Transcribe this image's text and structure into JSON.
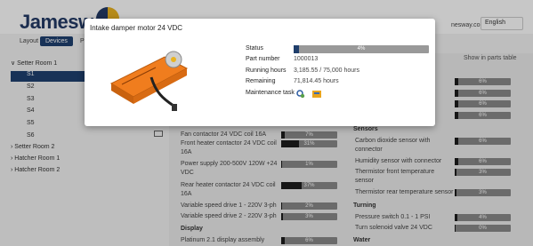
{
  "header": {
    "logo_text": "Jamesway",
    "user_text": "nesway.com ▾",
    "language": "English"
  },
  "tabs": [
    {
      "label": "Layout"
    },
    {
      "label": "Devices"
    },
    {
      "label": "Parts"
    },
    {
      "label": "C"
    }
  ],
  "tree": [
    {
      "label": "∨  Setter Room 1"
    },
    {
      "label": "S1"
    },
    {
      "label": "S2"
    },
    {
      "label": "S3"
    },
    {
      "label": "S4"
    },
    {
      "label": "S5"
    },
    {
      "label": "S6"
    },
    {
      "label": "›  Setter Room 2"
    },
    {
      "label": "›  Hatcher Room 1"
    },
    {
      "label": "›  Hatcher Room 2"
    }
  ],
  "right_header": "Show in parts table",
  "parts_left": [
    {
      "label": "Fan contactor 24 VDC coil 16A",
      "value": "7%",
      "fraction": 0.07
    },
    {
      "label": "Front heater contactor 24 VDC coil",
      "label2": "16A",
      "value": "31%",
      "fraction": 0.31
    },
    {
      "label": "Power supply 200-500V 120W +24",
      "label2": "VDC",
      "value": "1%",
      "fraction": 0.01
    },
    {
      "label": "Rear heater contactor 24 VDC coil",
      "label2": "16A",
      "value": "37%",
      "fraction": 0.37
    },
    {
      "label": "Variable speed drive 1 - 220V 3-ph",
      "value": "2%",
      "fraction": 0.02
    },
    {
      "label": "Variable speed drive 2 - 220V 3-ph",
      "value": "3%",
      "fraction": 0.03
    }
  ],
  "display_section": {
    "title": "Display",
    "item": {
      "label": "Platinum 2.1 display assembly",
      "value": "6%",
      "fraction": 0.06
    }
  },
  "right_top_values": [
    {
      "value": "6%",
      "fraction": 0.06
    },
    {
      "value": "6%",
      "fraction": 0.06
    },
    {
      "value": "6%",
      "fraction": 0.06
    },
    {
      "value": "6%",
      "fraction": 0.06
    }
  ],
  "sensors": {
    "title": "Sensors",
    "items": [
      {
        "label": "Carbon dioxide sensor with",
        "label2": "connector",
        "value": "6%",
        "fraction": 0.06
      },
      {
        "label": "Humidity sensor with connector",
        "value": "6%",
        "fraction": 0.06
      },
      {
        "label": "Thermistor front temperature",
        "label2": "sensor",
        "value": "3%",
        "fraction": 0.03
      },
      {
        "label": "Thermistor rear temperature sensor",
        "value": "3%",
        "fraction": 0.03
      }
    ]
  },
  "turning": {
    "title": "Turning",
    "items": [
      {
        "label": "Pressure switch 0.1 - 1 PSI",
        "value": "4%",
        "fraction": 0.04
      },
      {
        "label": "Turn solenoid valve 24 VDC",
        "value": "0%",
        "fraction": 0.0
      }
    ]
  },
  "water_title": "Water",
  "modal": {
    "title": "Intake damper motor 24 VDC",
    "fields": [
      {
        "label": "Status",
        "value": "4%",
        "fraction": 0.04
      },
      {
        "label": "Part number",
        "value": "1000013"
      },
      {
        "label": "Running hours",
        "value": "3,185.55 / 75,000 hours"
      },
      {
        "label": "Remaining",
        "value": "71,814.45 hours"
      },
      {
        "label": "Maintenance task",
        "icons": [
          "maintenance-gear-icon",
          "maintenance-tool-icon"
        ]
      }
    ]
  },
  "colors": {
    "primary": "#1f4070",
    "bar_bg": "#8a8a8a",
    "bar_fill": "#1d1d1d",
    "motor_orange": "#f07d1e"
  }
}
